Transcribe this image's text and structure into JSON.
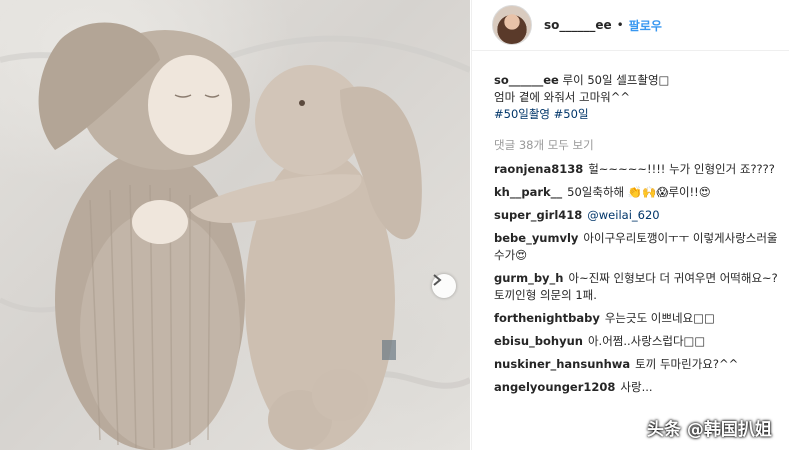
{
  "post": {
    "username": "so______ee",
    "dot": "•",
    "follow_label": "팔로우",
    "caption_user": "so______ee",
    "caption_line1": "루이 50일 셀프촬영□",
    "caption_line2": "엄마 곁에 와줘서 고마워^^",
    "hashtags": [
      "#50일촬영",
      "#50일"
    ],
    "view_all": "댓글 38개 모두 보기"
  },
  "comments": [
    {
      "user": "raonjena8138",
      "text": "헐~~~~~!!!! 누가 인형인거 죠????"
    },
    {
      "user": "kh__park__",
      "text": "50일축하해 👏🙌😱루이!!😍"
    },
    {
      "user": "super_girl418",
      "text": "@weilai_620"
    },
    {
      "user": "bebe_yumvly",
      "text": "아이구우리토깽이ㅜㅜ 이렇게사랑스러울수가😍"
    },
    {
      "user": "gurm_by_h",
      "text": "아~진짜 인형보다 더 귀여우면 어떡해요~? 토끼인형 의문의 1패."
    },
    {
      "user": "forthenightbaby",
      "text": "우는긋도 이쁘네요□□"
    },
    {
      "user": "ebisu_bohyun",
      "text": "아.어쩜..사랑스럽다□□"
    },
    {
      "user": "nuskiner_hansunhwa",
      "text": "토끼 두마린가요?^^"
    },
    {
      "user": "angelyounger1208",
      "text": "사랑..."
    }
  ],
  "watermark": "头条 @韩国扒姐",
  "icons": {
    "next": "chevron-right-icon"
  },
  "colors": {
    "follow": "#3897f0",
    "hashtag": "#003569",
    "muted": "#999999"
  }
}
